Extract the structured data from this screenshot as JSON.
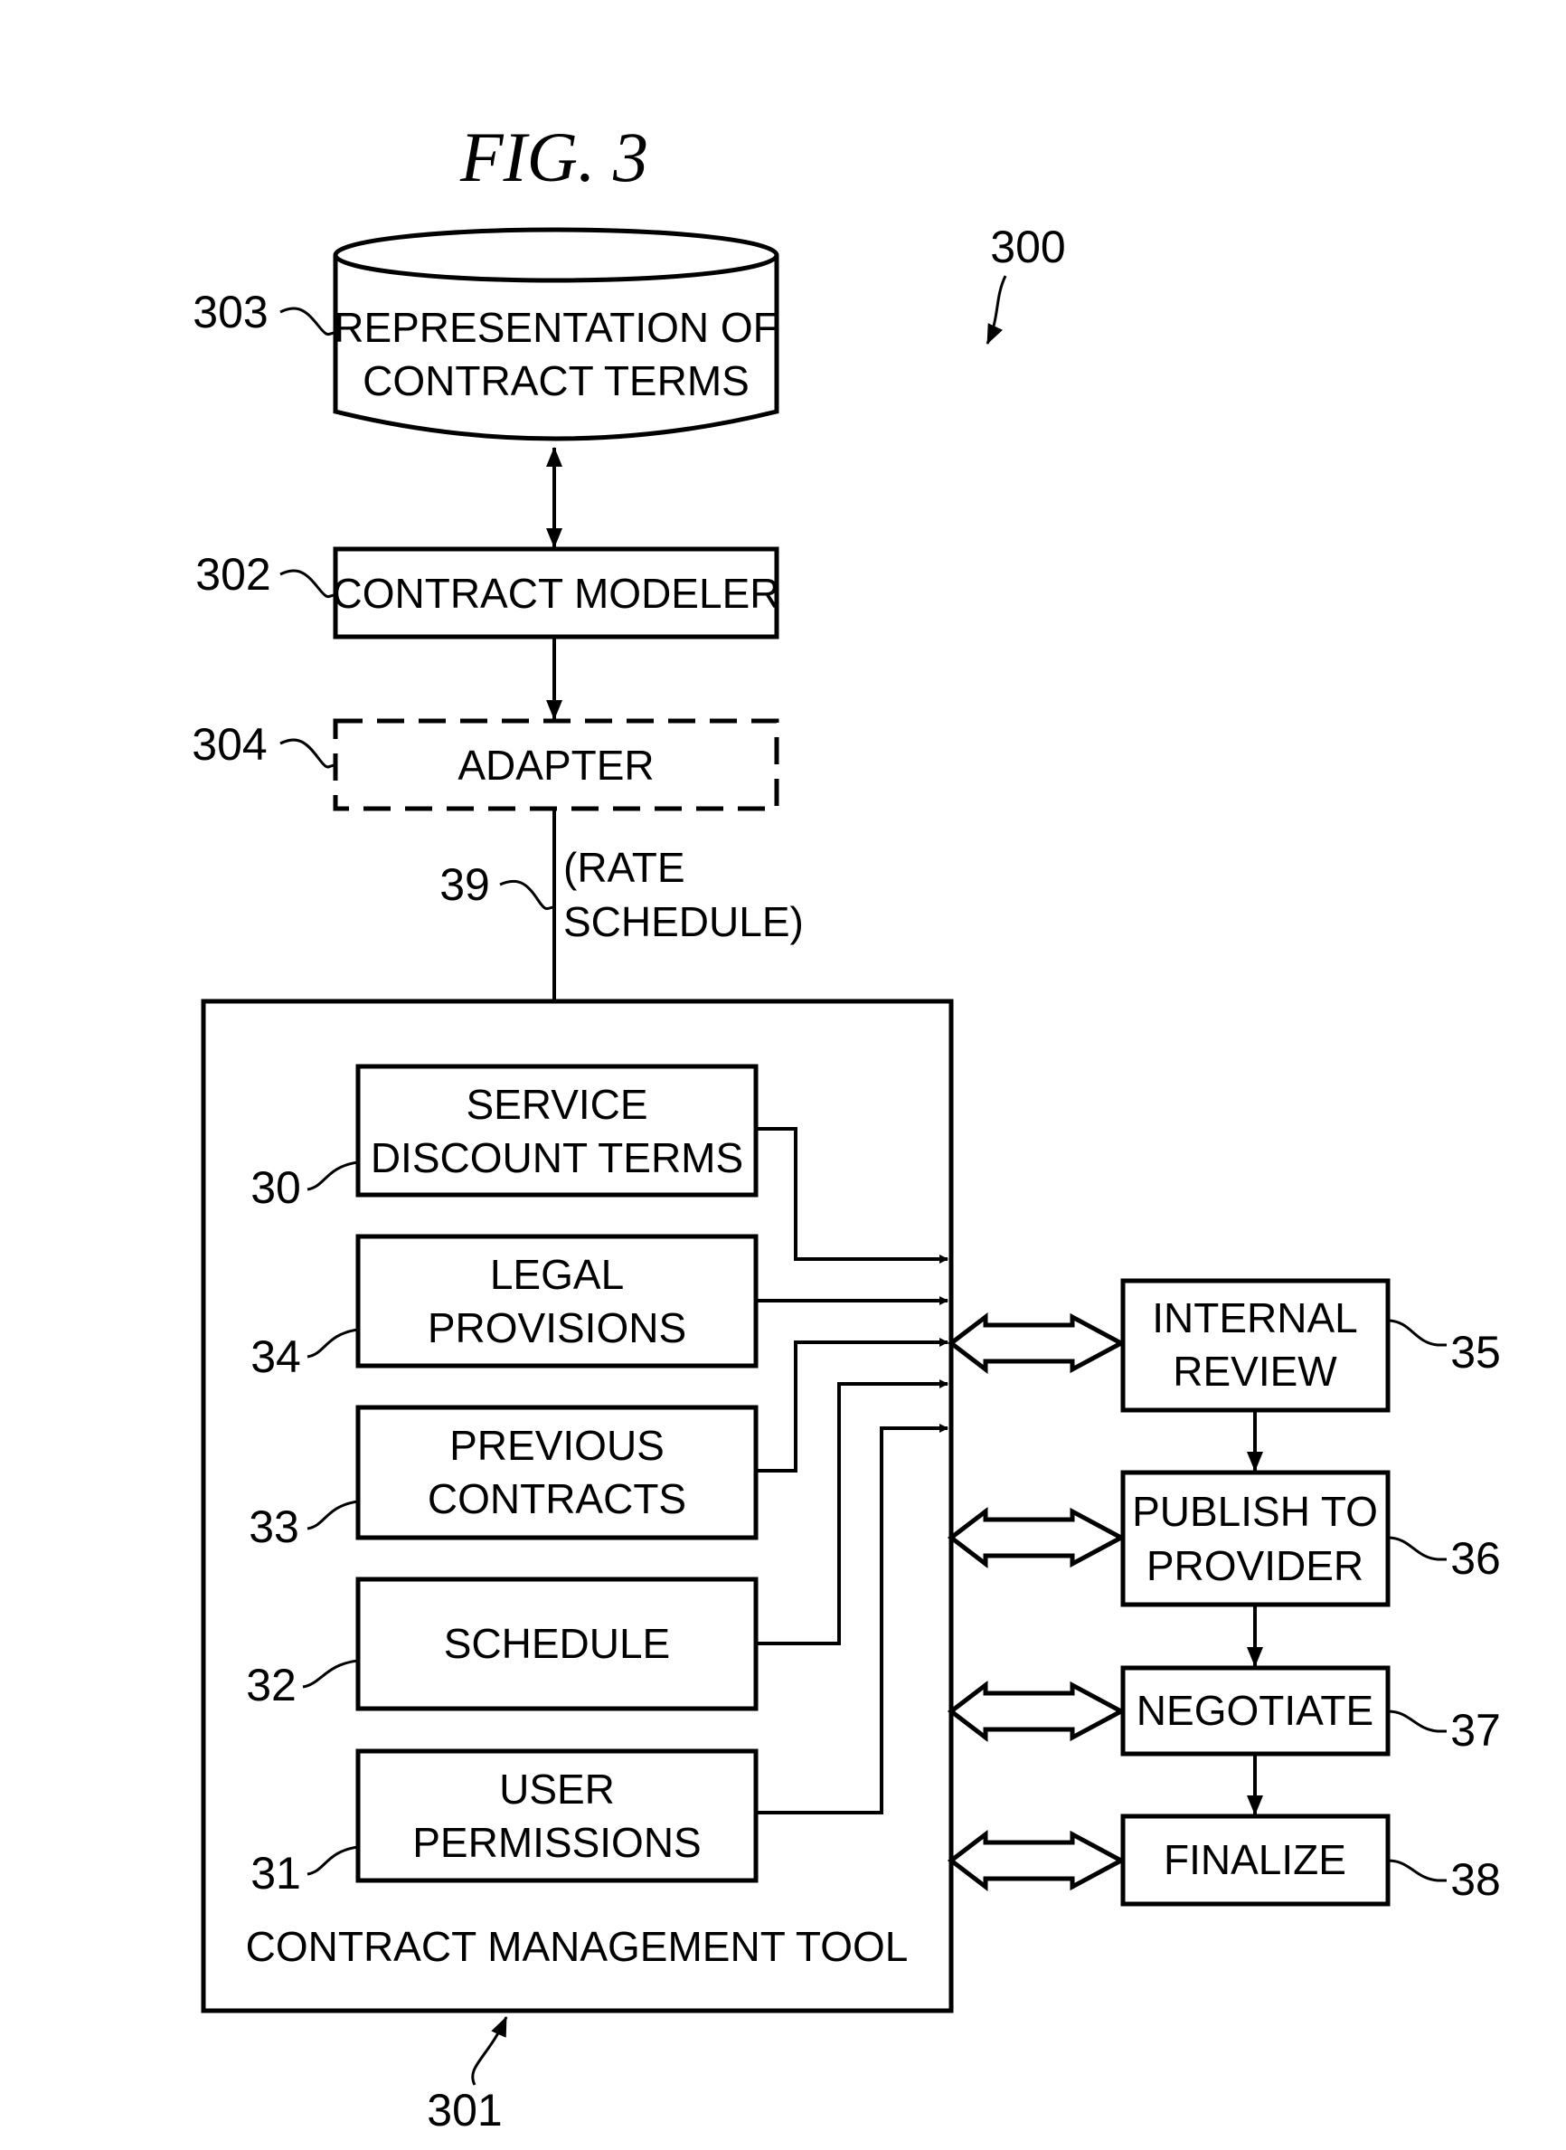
{
  "figure": {
    "title": "FIG. 3",
    "system_ref": "300"
  },
  "nodes": {
    "repository": {
      "ref": "303",
      "lines": [
        "REPRESENTATION OF",
        "CONTRACT TERMS"
      ]
    },
    "modeler": {
      "ref": "302",
      "lines": [
        "CONTRACT MODELER"
      ]
    },
    "adapter": {
      "ref": "304",
      "lines": [
        "ADAPTER"
      ]
    },
    "rate_schedule": {
      "ref": "39",
      "lines": [
        "(RATE",
        "SCHEDULE)"
      ]
    },
    "tool": {
      "ref": "301",
      "label": "CONTRACT MANAGEMENT TOOL"
    },
    "inner": [
      {
        "ref": "30",
        "lines": [
          "SERVICE",
          "DISCOUNT TERMS"
        ]
      },
      {
        "ref": "34",
        "lines": [
          "LEGAL",
          "PROVISIONS"
        ]
      },
      {
        "ref": "33",
        "lines": [
          "PREVIOUS",
          "CONTRACTS"
        ]
      },
      {
        "ref": "32",
        "lines": [
          "SCHEDULE"
        ]
      },
      {
        "ref": "31",
        "lines": [
          "USER",
          "PERMISSIONS"
        ]
      }
    ],
    "workflow": [
      {
        "ref": "35",
        "lines": [
          "INTERNAL",
          "REVIEW"
        ]
      },
      {
        "ref": "36",
        "lines": [
          "PUBLISH TO",
          "PROVIDER"
        ]
      },
      {
        "ref": "37",
        "lines": [
          "NEGOTIATE"
        ]
      },
      {
        "ref": "38",
        "lines": [
          "FINALIZE"
        ]
      }
    ]
  }
}
